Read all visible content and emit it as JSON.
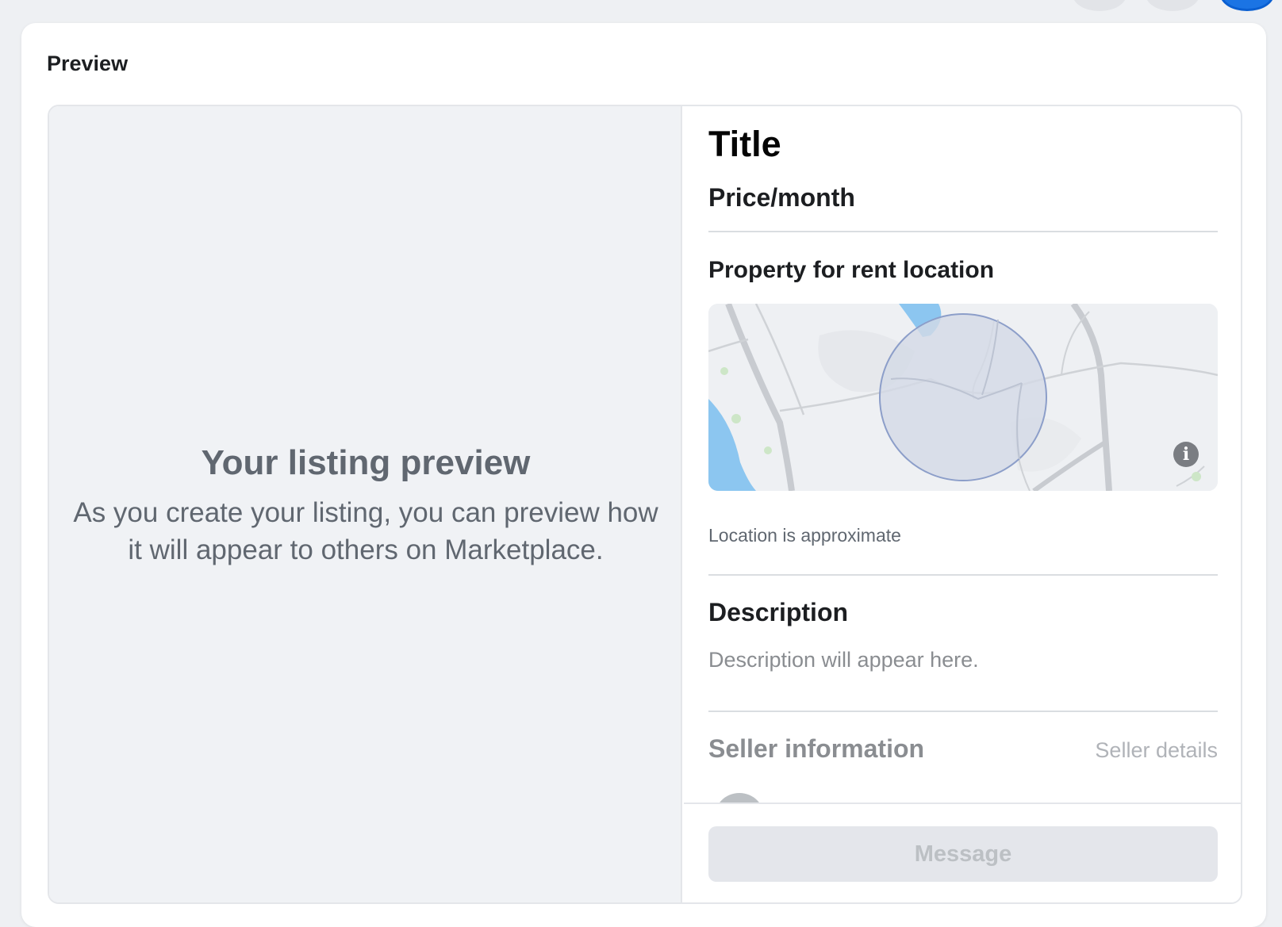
{
  "card": {
    "title": "Preview"
  },
  "left": {
    "heading": "Your listing preview",
    "subtext": "As you create your listing, you can preview how it will appear to others on Marketplace."
  },
  "listing": {
    "title": "Title",
    "price": "Price/month",
    "location_heading": "Property for rent location",
    "location_note": "Location is approximate",
    "description_heading": "Description",
    "description_placeholder": "Description will appear here.",
    "seller_heading": "Seller information",
    "seller_link": "Seller details",
    "message_button": "Message"
  },
  "map": {
    "info_icon": "info-icon"
  },
  "colors": {
    "accent": "#1b74e4",
    "panel_bg": "#f0f2f5",
    "water": "#8cc6f0",
    "radius_fill": "#d3d9e6",
    "radius_stroke": "#8c9ec9"
  }
}
